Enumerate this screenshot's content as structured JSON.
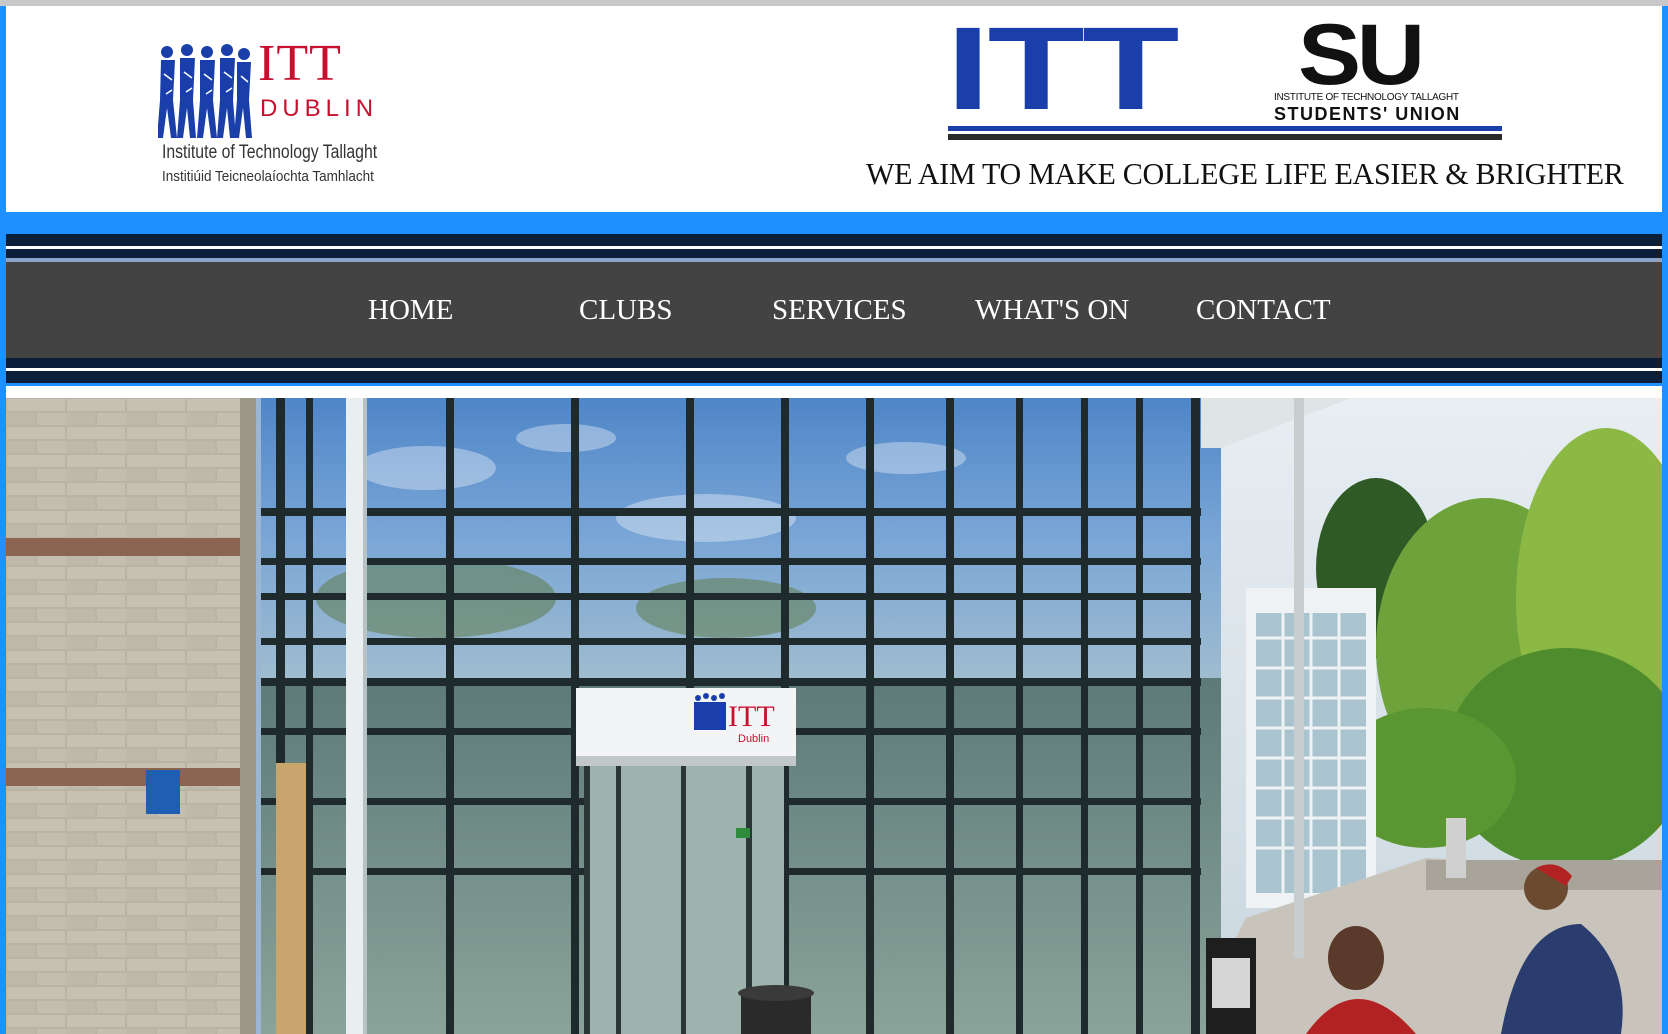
{
  "header": {
    "itt_logo": {
      "word": "ITT",
      "dublin": "DUBLIN",
      "line1": "Institute of Technology Tallaght",
      "line2": "Institiúid Teicneolaíochta Tamhlacht",
      "icon": "itt-figures-logo"
    },
    "su_logo": {
      "letters": "ITT",
      "su": "SU",
      "institute": "INSTITUTE OF TECHNOLOGY TALLAGHT",
      "union": "STUDENTS' UNION",
      "icon": "ittsu-logo"
    },
    "tagline": "WE AIM TO MAKE COLLEGE LIFE EASIER & BRIGHTER"
  },
  "nav": {
    "home": "HOME",
    "clubs": "CLUBS",
    "services": "SERVICES",
    "whats_on": "WHAT'S ON",
    "contact": "CONTACT"
  },
  "hero": {
    "sign_word": "ITT",
    "sign_sub": "Dublin",
    "image": "campus-building-photo"
  },
  "colors": {
    "frame": "#1e90ff",
    "nav_bg": "#434343",
    "stripe": "#0b1f3a",
    "itt_red": "#c8102e",
    "su_blue": "#1a3faa"
  }
}
